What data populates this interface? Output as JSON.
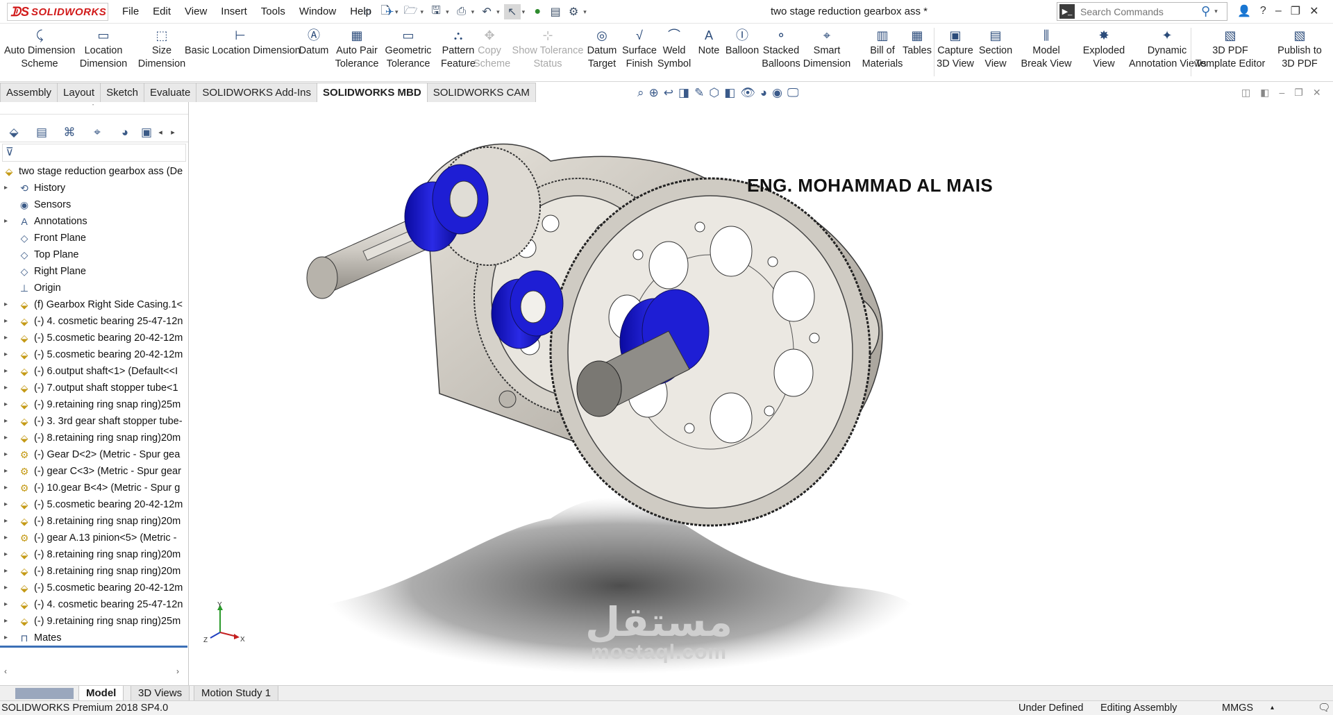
{
  "app": {
    "name": "SOLIDWORKS",
    "window_title": "two stage reduction gearbox ass *"
  },
  "menu": [
    "File",
    "Edit",
    "View",
    "Insert",
    "Tools",
    "Window",
    "Help"
  ],
  "search": {
    "placeholder": "Search Commands"
  },
  "ribbon": [
    {
      "label": "Auto Dimension\nScheme",
      "icon": "auto-dimension-icon",
      "enabled": true
    },
    {
      "label": "Location\nDimension",
      "icon": "location-dimension-icon",
      "enabled": true
    },
    {
      "label": "Size\nDimension",
      "icon": "size-dimension-icon",
      "enabled": true
    },
    {
      "label": "Basic Location Dimension",
      "icon": "basic-location-dimension-icon",
      "enabled": true
    },
    {
      "label": "Datum",
      "icon": "datum-icon",
      "enabled": true
    },
    {
      "label": "Auto Pair\nTolerance",
      "icon": "auto-pair-tolerance-icon",
      "enabled": true
    },
    {
      "label": "Geometric\nTolerance",
      "icon": "geometric-tolerance-icon",
      "enabled": true
    },
    {
      "label": "Pattern\nFeature",
      "icon": "pattern-feature-icon",
      "enabled": true
    },
    {
      "label": "Copy\nScheme",
      "icon": "copy-scheme-icon",
      "enabled": false
    },
    {
      "label": "Show Tolerance\nStatus",
      "icon": "show-tolerance-status-icon",
      "enabled": false
    },
    {
      "label": "Datum\nTarget",
      "icon": "datum-target-icon",
      "enabled": true
    },
    {
      "label": "Surface\nFinish",
      "icon": "surface-finish-icon",
      "enabled": true
    },
    {
      "label": "Weld\nSymbol",
      "icon": "weld-symbol-icon",
      "enabled": true
    },
    {
      "label": "Note",
      "icon": "note-icon",
      "enabled": true
    },
    {
      "label": "Balloon",
      "icon": "balloon-icon",
      "enabled": true
    },
    {
      "label": "Stacked\nBalloons",
      "icon": "stacked-balloons-icon",
      "enabled": true
    },
    {
      "label": "Smart\nDimension",
      "icon": "smart-dimension-icon",
      "enabled": true
    },
    {
      "label": "Bill of\nMaterials",
      "icon": "bill-of-materials-icon",
      "enabled": true
    },
    {
      "label": "Tables",
      "icon": "tables-icon",
      "enabled": true
    },
    {
      "label": "Capture\n3D View",
      "icon": "capture-3d-view-icon",
      "enabled": true
    },
    {
      "label": "Section\nView",
      "icon": "section-view-icon",
      "enabled": true
    },
    {
      "label": "Model\nBreak View",
      "icon": "model-break-view-icon",
      "enabled": true
    },
    {
      "label": "Exploded\nView",
      "icon": "exploded-view-icon",
      "enabled": true
    },
    {
      "label": "Dynamic\nAnnotation Views",
      "icon": "dynamic-annotation-views-icon",
      "enabled": true
    },
    {
      "label": "3D PDF\nTemplate Editor",
      "icon": "3d-pdf-template-editor-icon",
      "enabled": true
    },
    {
      "label": "Publish to\n3D PDF",
      "icon": "publish-3d-pdf-icon",
      "enabled": true
    }
  ],
  "tabs": [
    "Assembly",
    "Layout",
    "Sketch",
    "Evaluate",
    "SOLIDWORKS Add-Ins",
    "SOLIDWORKS MBD",
    "SOLIDWORKS CAM"
  ],
  "active_tab": "SOLIDWORKS MBD",
  "tree": {
    "root": "two stage reduction gearbox ass  (De",
    "items": [
      {
        "label": "History",
        "expandable": true,
        "icon": "history-icon"
      },
      {
        "label": "Sensors",
        "expandable": false,
        "icon": "sensors-icon"
      },
      {
        "label": "Annotations",
        "expandable": true,
        "icon": "annotations-icon"
      },
      {
        "label": "Front Plane",
        "expandable": false,
        "icon": "plane-icon"
      },
      {
        "label": "Top Plane",
        "expandable": false,
        "icon": "plane-icon"
      },
      {
        "label": "Right Plane",
        "expandable": false,
        "icon": "plane-icon"
      },
      {
        "label": "Origin",
        "expandable": false,
        "icon": "origin-icon"
      },
      {
        "label": "(f) Gearbox Right Side Casing.1<",
        "expandable": true,
        "icon": "part-icon"
      },
      {
        "label": "(-) 4. cosmetic bearing 25-47-12n",
        "expandable": true,
        "icon": "part-icon"
      },
      {
        "label": "(-) 5.cosmetic bearing 20-42-12m",
        "expandable": true,
        "icon": "part-icon"
      },
      {
        "label": "(-) 5.cosmetic bearing 20-42-12m",
        "expandable": true,
        "icon": "part-icon"
      },
      {
        "label": "(-) 6.output shaft<1> (Default<<I",
        "expandable": true,
        "icon": "part-icon"
      },
      {
        "label": "(-) 7.output shaft stopper tube<1",
        "expandable": true,
        "icon": "part-icon"
      },
      {
        "label": "(-) 9.retaining ring snap ring)25m",
        "expandable": true,
        "icon": "part-icon"
      },
      {
        "label": "(-) 3. 3rd gear shaft stopper tube-",
        "expandable": true,
        "icon": "part-icon"
      },
      {
        "label": "(-) 8.retaining ring snap ring)20m",
        "expandable": true,
        "icon": "part-icon"
      },
      {
        "label": "(-) Gear D<2> (Metric - Spur gea",
        "expandable": true,
        "icon": "gear-part-icon"
      },
      {
        "label": "(-) gear C<3> (Metric - Spur gear",
        "expandable": true,
        "icon": "gear-part-icon"
      },
      {
        "label": "(-) 10.gear B<4> (Metric - Spur g",
        "expandable": true,
        "icon": "gear-part-icon"
      },
      {
        "label": "(-) 5.cosmetic bearing 20-42-12m",
        "expandable": true,
        "icon": "part-icon"
      },
      {
        "label": "(-) 8.retaining ring snap ring)20m",
        "expandable": true,
        "icon": "part-icon"
      },
      {
        "label": "(-) gear A.13 pinion<5> (Metric -",
        "expandable": true,
        "icon": "gear-part-icon"
      },
      {
        "label": "(-) 8.retaining ring snap ring)20m",
        "expandable": true,
        "icon": "part-icon"
      },
      {
        "label": "(-) 8.retaining ring snap ring)20m",
        "expandable": true,
        "icon": "part-icon"
      },
      {
        "label": "(-) 5.cosmetic bearing 20-42-12m",
        "expandable": true,
        "icon": "part-icon"
      },
      {
        "label": "(-) 4. cosmetic bearing 25-47-12n",
        "expandable": true,
        "icon": "part-icon"
      },
      {
        "label": "(-) 9.retaining ring snap ring)25m",
        "expandable": true,
        "icon": "part-icon"
      },
      {
        "label": "Mates",
        "expandable": true,
        "icon": "mates-icon"
      }
    ]
  },
  "viewport": {
    "overlay_text": "ENG. MOHAMMAD AL MAIS",
    "watermark_arabic": "مستقل",
    "watermark_latin": "mostaql.com"
  },
  "triad": {
    "x": "X",
    "y": "Y",
    "z": "Z"
  },
  "bottom_tabs": [
    "Model",
    "3D Views",
    "Motion Study 1"
  ],
  "active_bottom_tab": "Model",
  "status": {
    "product": "SOLIDWORKS Premium 2018 SP4.0",
    "state": "Under Defined",
    "mode": "Editing Assembly",
    "units": "MMGS"
  },
  "colors": {
    "brand": "#d11a1a",
    "accent": "#3b6fb6",
    "bearing": "#1a1ac8",
    "casing": "#c8c4bc"
  }
}
